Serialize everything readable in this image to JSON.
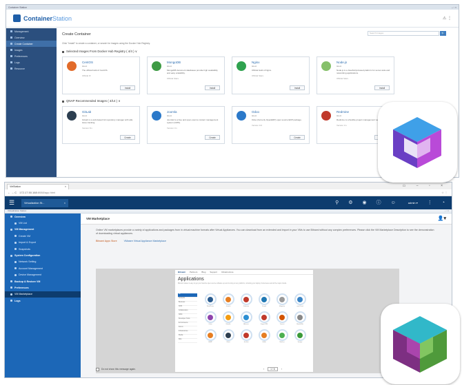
{
  "container_station": {
    "window_title": "Container Station",
    "window_controls": "– ▫ ×",
    "logo_bold": "Container",
    "logo_light": "Station",
    "header_icons": "⚠ ⋮",
    "sidebar": [
      {
        "label": "Management",
        "active": false
      },
      {
        "label": "Overview",
        "active": false
      },
      {
        "label": "Create Container",
        "active": true
      },
      {
        "label": "Images",
        "active": false
      },
      {
        "label": "Preferences",
        "active": false
      },
      {
        "label": "Logs",
        "active": false
      },
      {
        "label": "Resource",
        "active": false
      }
    ],
    "page_title": "Create Container",
    "search_placeholder": "Search Images",
    "search_button": "🔍",
    "intro": "Click \"Install\" to create a container, or search for images using the Docker Hub Registry.",
    "section1": "Selected Images From Docker Hub Registry ( 4/4 )  ∨",
    "section2": "QNAP Recommended Images ( 4/14 )  ∨",
    "cards_top": [
      {
        "name": "CentOS",
        "tag": "latest",
        "desc": "The official build of CentOS.",
        "meta": "Official   ★",
        "button": "Install",
        "color": "#e26b2a"
      },
      {
        "name": "MongoDB",
        "tag": "latest",
        "desc": "MongoDB document databases provide high availability and easy scalability.",
        "meta": "Official   Stars",
        "button": "Install",
        "color": "#3f9b45"
      },
      {
        "name": "Nginx",
        "tag": "latest",
        "desc": "Official build of Nginx.",
        "meta": "Official   Stars",
        "button": "Install",
        "color": "#2fa24f"
      },
      {
        "name": "Node.js",
        "tag": "latest",
        "desc": "Node.js is a JavaScript-based platform for server-side and networking applications.",
        "meta": "Official   Stars",
        "button": "Install",
        "color": "#86c06a"
      }
    ],
    "cards_bottom": [
      {
        "name": "GitLab",
        "tag": "latest",
        "desc": "GitLab is a web-based Git repository manager with wiki, issue tracking.",
        "meta": "Version   8.x",
        "button": "Create",
        "color": "#2c3e50"
      },
      {
        "name": "Joomla",
        "tag": "latest",
        "desc": "Joomla! is a free and open-source content management system (CMS).",
        "meta": "Version   3.x",
        "button": "Create",
        "color": "#2b79c9"
      },
      {
        "name": "Odoo",
        "tag": "latest",
        "desc": "Odoo (formerly OpenERP) open source ERP package.",
        "meta": "Version   9.0",
        "button": "Create",
        "color": "#2b79c9"
      },
      {
        "name": "Redmine",
        "tag": "latest",
        "desc": "Redmine is a flexible project management web application.",
        "meta": "Version   3.x",
        "button": "Create",
        "color": "#c0392b"
      }
    ]
  },
  "virtualization_station": {
    "browser_tab": "VirtStation",
    "browser_tab_close": "×",
    "browser_controls": "▭ – ▫ ×",
    "nav_buttons": "← → C",
    "url_host": "172.17.50.168",
    "url_path": ":8088/app.html",
    "addr_right": "☆ ⋮",
    "app_tab": "Virtualization St...",
    "app_tab_close": "×",
    "user": "admin ▾",
    "titlestrip_label": "Virtualization Station",
    "titlestrip_controls": "– ▫ ×",
    "sidebar": [
      {
        "label": "Overview",
        "type": "head"
      },
      {
        "label": "VM List",
        "type": "sub"
      },
      {
        "label": "VM Management",
        "type": "head"
      },
      {
        "label": "Create VM",
        "type": "sub"
      },
      {
        "label": "Import & Export",
        "type": "sub"
      },
      {
        "label": "Snapshots",
        "type": "sub"
      },
      {
        "label": "System Configuration",
        "type": "head"
      },
      {
        "label": "Network Setting",
        "type": "sub"
      },
      {
        "label": "Account Management",
        "type": "sub"
      },
      {
        "label": "Device Management",
        "type": "sub"
      },
      {
        "label": "Backup & Restore VM",
        "type": "head"
      },
      {
        "label": "Preferences",
        "type": "head"
      },
      {
        "label": "VM Marketplace",
        "type": "active"
      },
      {
        "label": "Logs",
        "type": "head"
      }
    ],
    "section_title": "VM Marketplace",
    "section_icon": "👤▾",
    "description": "Online VM marketplaces provide a variety of applications and packages from in virtual machine formats after Virtual Appliances. You can download from an extended and import in your VMs to use Bitnami without any complex preferences. Please click the VM Marketplace Description to see the demonstration of downloading virtual appliances.",
    "link1": "Bitnami Apps Store",
    "link2": "VMware Virtual Appliance Marketplace",
    "inner_nav": [
      "Bitnami",
      "Partners",
      "Blog",
      "Support",
      "Infrastructure"
    ],
    "inner_title": "Applications",
    "inner_sub": "Bitnami makes it easy to get your favorite open source software up and running on any platform, including your laptop, Kubernetes and all the major clouds.",
    "categories": [
      "All",
      "Analytics",
      "Business",
      "CMS",
      "Collaboration",
      "CRM",
      "Developer Tools",
      "E-Commerce",
      "Forum",
      "Infrastructure",
      "Media",
      "Wiki"
    ],
    "apps": [
      {
        "name": "WordPress",
        "color": "#2b5c8f"
      },
      {
        "name": "Joomla",
        "color": "#e67e22"
      },
      {
        "name": "Redmine",
        "color": "#c0392b"
      },
      {
        "name": "Drupal",
        "color": "#1f78b4"
      },
      {
        "name": "Magento",
        "color": "#999999"
      },
      {
        "name": "ownCloud",
        "color": "#3a84c5"
      },
      {
        "name": "Odoo",
        "color": "#8e44ad"
      },
      {
        "name": "Moodle",
        "color": "#f39c12"
      },
      {
        "name": "Alfresco",
        "color": "#2c8fd3"
      },
      {
        "name": "SugarCRM",
        "color": "#c0392b"
      },
      {
        "name": "Tomcat",
        "color": "#d35400"
      },
      {
        "name": "MediaWiki",
        "color": "#888888"
      },
      {
        "name": "LAMP",
        "color": "#e67e22"
      },
      {
        "name": "Ghost",
        "color": "#2c3e50"
      },
      {
        "name": "Jenkins",
        "color": "#c0392b"
      },
      {
        "name": "Gitlab",
        "color": "#e67e22"
      },
      {
        "name": "Node.js",
        "color": "#4caf50"
      },
      {
        "name": "Django",
        "color": "#3a9a3a"
      }
    ],
    "footer_checkbox_label": "Do not show this message again.",
    "pager": "1 / 6",
    "footer_right": "Go To Demo ⓘ"
  }
}
